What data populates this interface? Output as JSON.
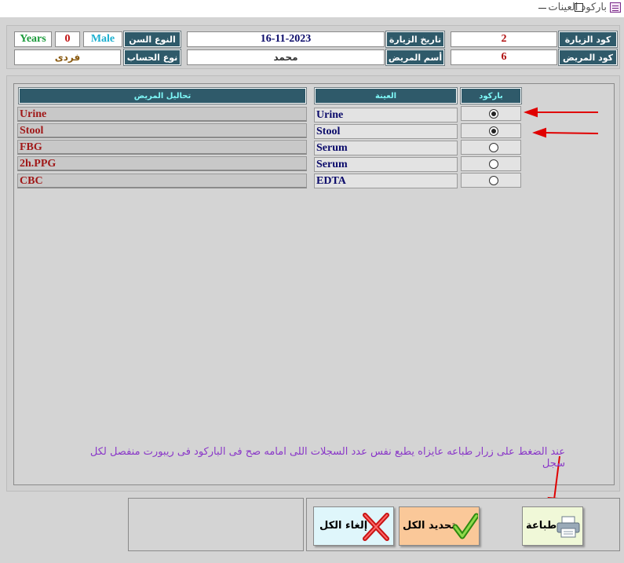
{
  "window": {
    "title": "باركود العينات",
    "icon": "form-icon"
  },
  "header": {
    "visit_code_label": "كود الزيارة",
    "visit_code": "2",
    "visit_date_label": "تاريخ الزيارة",
    "visit_date": "16-11-2023",
    "gender_age_label": "النوع السن",
    "gender": "Male",
    "age": "0",
    "age_unit": "Years",
    "patient_code_label": "كود المريض",
    "patient_code": "6",
    "patient_name_label": "أسم المريض",
    "patient_name": "محمد",
    "account_type_label": "نوع الحساب",
    "account_type": "فردى"
  },
  "table": {
    "columns": {
      "barcode": "باركود",
      "sample": "العينة",
      "tests": "تحاليل المريض"
    },
    "rows": [
      {
        "test": "Urine",
        "sample": "Urine",
        "selected": true
      },
      {
        "test": "Stool",
        "sample": "Stool",
        "selected": true
      },
      {
        "test": "FBG",
        "sample": "Serum",
        "selected": false
      },
      {
        "test": "2h.PPG",
        "sample": "Serum",
        "selected": false
      },
      {
        "test": "CBC",
        "sample": "EDTA",
        "selected": false
      }
    ]
  },
  "note": "عند الضغط على زرار طباعه عايزاه يطبع نفس عدد السجلات اللى امامه صح فى الباركود فى ريبورت منفصل لكل سجل",
  "buttons": {
    "print": "طباعة",
    "select_all": "تحديد الكل",
    "clear_all": "إلغاء الكل"
  },
  "colors": {
    "label_bg": "#2f5a6a",
    "arrow": "#e00000",
    "test_text": "#a01818",
    "sample_text": "#0a0a6a",
    "note_text": "#8a38c8"
  }
}
